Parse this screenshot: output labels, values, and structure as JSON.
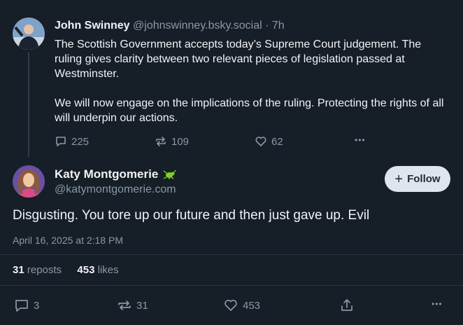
{
  "parent_post": {
    "author_name": "John Swinney",
    "author_handle": "@johnswinney.bsky.social",
    "time_ago": "· 7h",
    "paragraph1": "The Scottish Government accepts today’s Supreme Court judgement. The ruling gives clarity between two relevant pieces of legislation passed at Westminster.",
    "paragraph2": "We will now engage on the implications of the ruling. Protecting the rights of all will underpin our actions.",
    "replies": "225",
    "reposts": "109",
    "likes": "62",
    "more": "•••"
  },
  "main_post": {
    "author_name": "Katy Montgomerie",
    "author_handle": "@katymontgomerie.com",
    "follow_label": "Follow",
    "text": "Disgusting. You tore up our future and then just gave up. Evil",
    "timestamp": "April 16, 2025 at 2:18 PM",
    "repost_count": "31",
    "repost_label": "reposts",
    "like_count": "453",
    "like_label": "likes",
    "actions": {
      "replies": "3",
      "reposts": "31",
      "likes": "453",
      "more": "•••"
    }
  },
  "colors": {
    "background": "#161e27",
    "text": "#f1f3f5",
    "muted": "#8b98a8",
    "follow_button_bg": "#dfe5ec",
    "bug_badge": "#7ed321"
  },
  "icons": [
    "reply-icon",
    "repost-icon",
    "like-icon",
    "share-icon",
    "more-icon",
    "plus-icon",
    "bug-badge-icon"
  ]
}
